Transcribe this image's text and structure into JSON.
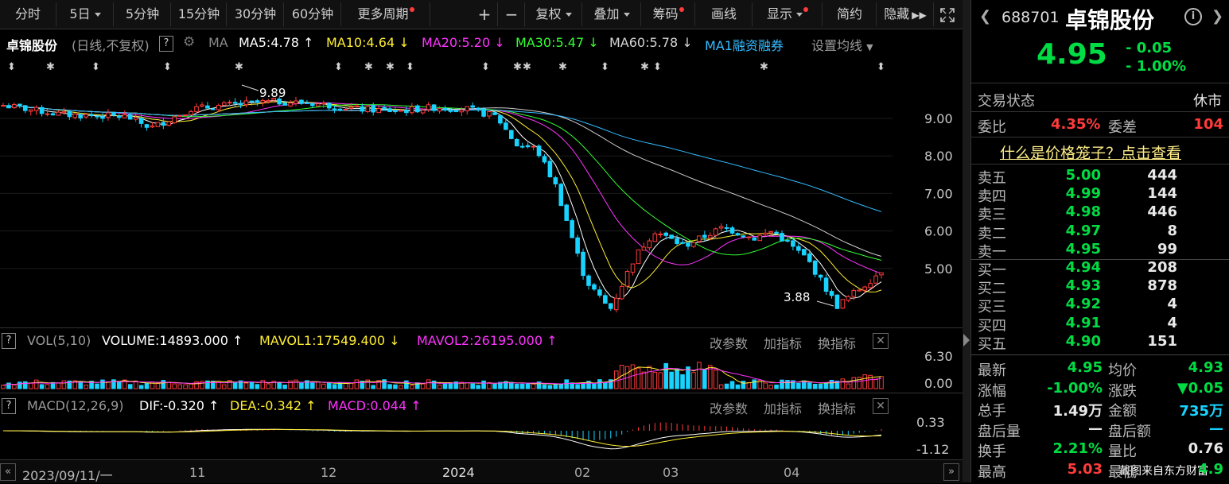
{
  "toolbar": {
    "period_tabs": [
      "分时",
      "5日",
      "5分钟",
      "15分钟",
      "30分钟",
      "60分钟",
      "更多周期"
    ],
    "tools": [
      "+",
      "−",
      "复权",
      "叠加",
      "筹码",
      "画线",
      "显示",
      "简约",
      "隐藏"
    ]
  },
  "chart_header": {
    "name": "卓锦股份",
    "mode": "(日线,不复权)",
    "q": "?",
    "ma_label": "MA",
    "ma5": "MA5:4.78",
    "ma10": "MA10:4.64",
    "ma20": "MA20:5.20",
    "ma30": "MA30:5.47",
    "ma60": "MA60:5.78",
    "ma1": "MA1融资融券",
    "set_ma": "设置均线"
  },
  "annotations": {
    "high": "9.89",
    "low": "3.88"
  },
  "price_axis": [
    "9.00",
    "8.00",
    "7.00",
    "6.00",
    "5.00"
  ],
  "vol_header": {
    "name": "VOL(5,10)",
    "volume": "VOLUME:14893.000",
    "mavol1": "MAVOL1:17549.400",
    "mavol2": "MAVOL2:26195.000",
    "btn_param": "改参数",
    "btn_add": "加指标",
    "btn_swap": "换指标"
  },
  "vol_axis": [
    "6.30",
    "0.00"
  ],
  "macd_header": {
    "name": "MACD(12,26,9)",
    "dif": "DIF:-0.320",
    "dea": "DEA:-0.342",
    "macd": "MACD:0.044",
    "btn_param": "改参数",
    "btn_add": "加指标",
    "btn_swap": "换指标"
  },
  "macd_axis": [
    "0.33",
    "-1.12"
  ],
  "date_axis": {
    "start": "2023/09/11/一",
    "labels": [
      "11",
      "12",
      "2024",
      "02",
      "03",
      "04"
    ]
  },
  "panel": {
    "code": "688701",
    "name": "卓锦股份",
    "price": "4.95",
    "change": "- 0.05",
    "change_pct": "- 1.00%",
    "status_label": "交易状态",
    "status": "休市",
    "weibi_label": "委比",
    "weibi": "4.35%",
    "weicha_label": "委差",
    "weicha": "104",
    "cage_link": "什么是价格笼子？点击查看",
    "asks": [
      {
        "label": "卖五",
        "price": "5.00",
        "vol": "444"
      },
      {
        "label": "卖四",
        "price": "4.99",
        "vol": "144"
      },
      {
        "label": "卖三",
        "price": "4.98",
        "vol": "446"
      },
      {
        "label": "卖二",
        "price": "4.97",
        "vol": "8"
      },
      {
        "label": "卖一",
        "price": "4.95",
        "vol": "99"
      }
    ],
    "bids": [
      {
        "label": "买一",
        "price": "4.94",
        "vol": "208"
      },
      {
        "label": "买二",
        "price": "4.93",
        "vol": "878"
      },
      {
        "label": "买三",
        "price": "4.92",
        "vol": "4"
      },
      {
        "label": "买四",
        "price": "4.91",
        "vol": "4"
      },
      {
        "label": "买五",
        "price": "4.90",
        "vol": "151"
      }
    ],
    "stats": [
      {
        "l1": "最新",
        "v1": "4.95",
        "l2": "均价",
        "v2": "4.93"
      },
      {
        "l1": "涨幅",
        "v1": "-1.00%",
        "l2": "涨跌",
        "v2": "▼0.05"
      },
      {
        "l1": "总手",
        "v1": "1.49万",
        "l2": "金额",
        "v2": "735万"
      },
      {
        "l1": "盘后量",
        "v1": "—",
        "l2": "盘后额",
        "v2": "—"
      },
      {
        "l1": "换手",
        "v1": "2.21%",
        "l2": "量比",
        "v2": "0.76"
      },
      {
        "l1": "最高",
        "v1": "5.03",
        "l2": "最低",
        "v2": "4.9"
      }
    ],
    "watermark": "截图来自东方财富"
  },
  "colors": {
    "up": "#ff3b3b",
    "down": "#19d3ff",
    "ma5": "#ffffff",
    "ma10": "#ffee33",
    "ma20": "#ff33ff",
    "ma30": "#33ff33",
    "ma60": "#cccccc",
    "ma1": "#33bbff"
  }
}
